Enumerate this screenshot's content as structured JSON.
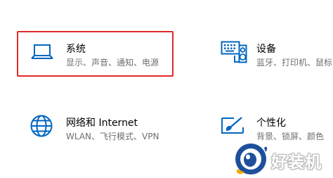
{
  "settings": {
    "tiles": [
      {
        "title": "系统",
        "subtitle": "显示、声音、通知、电源",
        "icon": "laptop-icon",
        "highlighted": true
      },
      {
        "title": "设备",
        "subtitle": "蓝牙、打印机、鼠标",
        "icon": "devices-icon",
        "highlighted": false
      },
      {
        "title": "网络和 Internet",
        "subtitle": "WLAN、飞行模式、VPN",
        "icon": "globe-icon",
        "highlighted": false
      },
      {
        "title": "个性化",
        "subtitle": "背景、锁屏、颜色",
        "icon": "paint-icon",
        "highlighted": false
      }
    ]
  },
  "watermark": {
    "text": "好装机"
  },
  "colors": {
    "accent": "#0067c0",
    "highlight_border": "#e02a2a",
    "title_text": "#000000",
    "subtitle_text": "#6f6f6f",
    "background": "#ffffff"
  }
}
